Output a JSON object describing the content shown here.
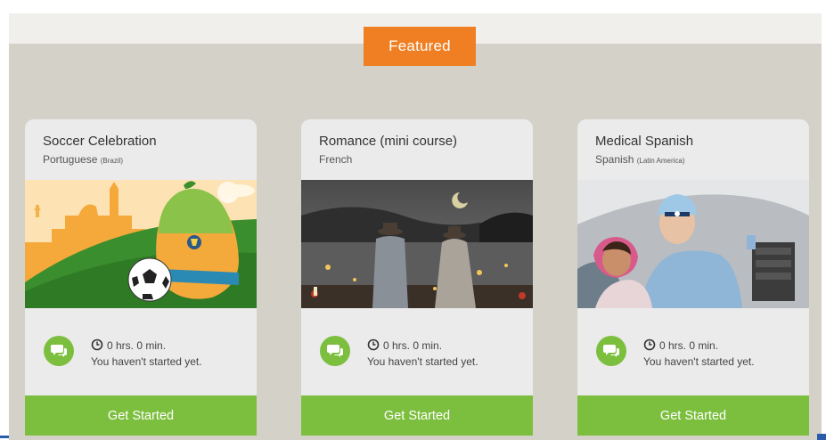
{
  "featured_tab": {
    "label": "Featured"
  },
  "accent_colors": {
    "orange": "#ef7f22",
    "green": "#7cbf3e",
    "frame": "#d4d2c8"
  },
  "cards": [
    {
      "title": "Soccer Celebration",
      "language": "Portuguese",
      "region": "(Brazil)",
      "time": "0 hrs. 0 min.",
      "status": "You haven't started yet.",
      "button": "Get Started",
      "image_icon": "soccer-pear-illustration"
    },
    {
      "title": "Romance (mini course)",
      "language": "French",
      "region": "",
      "time": "0 hrs. 0 min.",
      "status": "You haven't started yet.",
      "button": "Get Started",
      "image_icon": "night-couple-photo"
    },
    {
      "title": "Medical Spanish",
      "language": "Spanish",
      "region": "(Latin America)",
      "time": "0 hrs. 0 min.",
      "status": "You haven't started yet.",
      "button": "Get Started",
      "image_icon": "doctor-child-photo"
    }
  ]
}
